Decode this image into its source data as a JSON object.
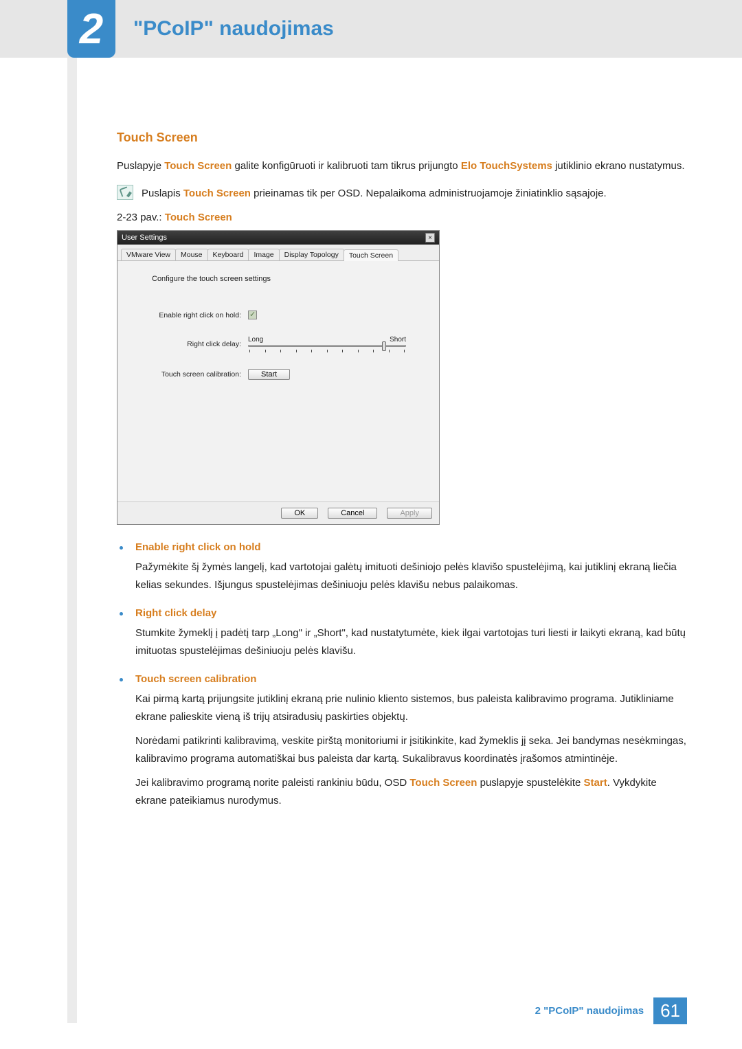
{
  "header": {
    "chapter_number": "2",
    "chapter_title": "\"PCoIP\" naudojimas"
  },
  "section": {
    "heading": "Touch Screen",
    "intro_prefix": "Puslapyje ",
    "intro_hl1": "Touch Screen",
    "intro_mid": " galite konfigūruoti ir kalibruoti tam tikrus prijungto ",
    "intro_hl2": "Elo TouchSystems",
    "intro_suffix": " jutiklinio ekrano nustatymus.",
    "note_prefix": "Puslapis ",
    "note_hl": "Touch Screen",
    "note_suffix": " prieinamas tik per OSD. Nepalaikoma administruojamoje žiniatinklio sąsajoje.",
    "fig_prefix": "2-23 pav.: ",
    "fig_hl": "Touch Screen"
  },
  "dialog": {
    "title": "User Settings",
    "close": "×",
    "tabs": [
      "VMware View",
      "Mouse",
      "Keyboard",
      "Image",
      "Display Topology",
      "Touch Screen"
    ],
    "active_tab_index": 5,
    "body_heading": "Configure the touch screen settings",
    "row1_label": "Enable right click on hold:",
    "row2_label": "Right click delay:",
    "slider_long": "Long",
    "slider_short": "Short",
    "row3_label": "Touch screen calibration:",
    "start_button": "Start",
    "ok": "OK",
    "cancel": "Cancel",
    "apply": "Apply"
  },
  "bullets": {
    "b1": {
      "title": "Enable right click on hold",
      "body": "Pažymėkite šį žymės langelį, kad vartotojai galėtų imituoti dešiniojo pelės klavišo spustelėjimą, kai jutiklinį ekraną liečia kelias sekundes. Išjungus spustelėjimas dešiniuoju pelės klavišu nebus palaikomas."
    },
    "b2": {
      "title": "Right click delay",
      "body": "Stumkite žymeklį į padėtį tarp „Long\" ir „Short\", kad nustatytumėte, kiek ilgai vartotojas turi liesti ir laikyti ekraną, kad būtų imituotas spustelėjimas dešiniuoju pelės klavišu."
    },
    "b3": {
      "title": "Touch screen calibration",
      "p1": "Kai pirmą kartą prijungsite jutiklinį ekraną prie nulinio kliento sistemos, bus paleista kalibravimo programa. Jutikliniame ekrane palieskite vieną iš trijų atsiradusių paskirties objektų.",
      "p2": "Norėdami patikrinti kalibravimą, veskite pirštą monitoriumi ir įsitikinkite, kad žymeklis jį seka. Jei bandymas nesėkmingas, kalibravimo programa automatiškai bus paleista dar kartą. Sukalibravus koordinatės įrašomos atmintinėje.",
      "p3_prefix": "Jei kalibravimo programą norite paleisti rankiniu būdu, OSD ",
      "p3_hl1": "Touch Screen",
      "p3_mid": " puslapyje spustelėkite ",
      "p3_hl2": "Start",
      "p3_suffix": ". Vykdykite ekrane pateikiamus nurodymus."
    }
  },
  "footer": {
    "text": "2 \"PCoIP\" naudojimas",
    "page": "61"
  }
}
